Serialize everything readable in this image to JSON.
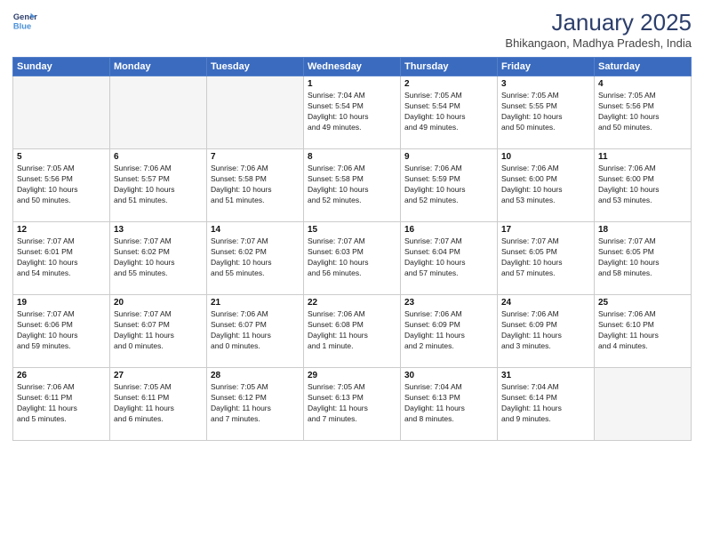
{
  "header": {
    "logo_line1": "General",
    "logo_line2": "Blue",
    "month": "January 2025",
    "location": "Bhikangaon, Madhya Pradesh, India"
  },
  "weekdays": [
    "Sunday",
    "Monday",
    "Tuesday",
    "Wednesday",
    "Thursday",
    "Friday",
    "Saturday"
  ],
  "weeks": [
    [
      {
        "day": "",
        "text": "",
        "shaded": false
      },
      {
        "day": "",
        "text": "",
        "shaded": false
      },
      {
        "day": "",
        "text": "",
        "shaded": false
      },
      {
        "day": "1",
        "text": "Sunrise: 7:04 AM\nSunset: 5:54 PM\nDaylight: 10 hours\nand 49 minutes.",
        "shaded": false
      },
      {
        "day": "2",
        "text": "Sunrise: 7:05 AM\nSunset: 5:54 PM\nDaylight: 10 hours\nand 49 minutes.",
        "shaded": false
      },
      {
        "day": "3",
        "text": "Sunrise: 7:05 AM\nSunset: 5:55 PM\nDaylight: 10 hours\nand 50 minutes.",
        "shaded": false
      },
      {
        "day": "4",
        "text": "Sunrise: 7:05 AM\nSunset: 5:56 PM\nDaylight: 10 hours\nand 50 minutes.",
        "shaded": false
      }
    ],
    [
      {
        "day": "5",
        "text": "Sunrise: 7:05 AM\nSunset: 5:56 PM\nDaylight: 10 hours\nand 50 minutes.",
        "shaded": true
      },
      {
        "day": "6",
        "text": "Sunrise: 7:06 AM\nSunset: 5:57 PM\nDaylight: 10 hours\nand 51 minutes.",
        "shaded": false
      },
      {
        "day": "7",
        "text": "Sunrise: 7:06 AM\nSunset: 5:58 PM\nDaylight: 10 hours\nand 51 minutes.",
        "shaded": false
      },
      {
        "day": "8",
        "text": "Sunrise: 7:06 AM\nSunset: 5:58 PM\nDaylight: 10 hours\nand 52 minutes.",
        "shaded": false
      },
      {
        "day": "9",
        "text": "Sunrise: 7:06 AM\nSunset: 5:59 PM\nDaylight: 10 hours\nand 52 minutes.",
        "shaded": false
      },
      {
        "day": "10",
        "text": "Sunrise: 7:06 AM\nSunset: 6:00 PM\nDaylight: 10 hours\nand 53 minutes.",
        "shaded": false
      },
      {
        "day": "11",
        "text": "Sunrise: 7:06 AM\nSunset: 6:00 PM\nDaylight: 10 hours\nand 53 minutes.",
        "shaded": false
      }
    ],
    [
      {
        "day": "12",
        "text": "Sunrise: 7:07 AM\nSunset: 6:01 PM\nDaylight: 10 hours\nand 54 minutes.",
        "shaded": true
      },
      {
        "day": "13",
        "text": "Sunrise: 7:07 AM\nSunset: 6:02 PM\nDaylight: 10 hours\nand 55 minutes.",
        "shaded": false
      },
      {
        "day": "14",
        "text": "Sunrise: 7:07 AM\nSunset: 6:02 PM\nDaylight: 10 hours\nand 55 minutes.",
        "shaded": false
      },
      {
        "day": "15",
        "text": "Sunrise: 7:07 AM\nSunset: 6:03 PM\nDaylight: 10 hours\nand 56 minutes.",
        "shaded": false
      },
      {
        "day": "16",
        "text": "Sunrise: 7:07 AM\nSunset: 6:04 PM\nDaylight: 10 hours\nand 57 minutes.",
        "shaded": false
      },
      {
        "day": "17",
        "text": "Sunrise: 7:07 AM\nSunset: 6:05 PM\nDaylight: 10 hours\nand 57 minutes.",
        "shaded": false
      },
      {
        "day": "18",
        "text": "Sunrise: 7:07 AM\nSunset: 6:05 PM\nDaylight: 10 hours\nand 58 minutes.",
        "shaded": false
      }
    ],
    [
      {
        "day": "19",
        "text": "Sunrise: 7:07 AM\nSunset: 6:06 PM\nDaylight: 10 hours\nand 59 minutes.",
        "shaded": true
      },
      {
        "day": "20",
        "text": "Sunrise: 7:07 AM\nSunset: 6:07 PM\nDaylight: 11 hours\nand 0 minutes.",
        "shaded": false
      },
      {
        "day": "21",
        "text": "Sunrise: 7:06 AM\nSunset: 6:07 PM\nDaylight: 11 hours\nand 0 minutes.",
        "shaded": false
      },
      {
        "day": "22",
        "text": "Sunrise: 7:06 AM\nSunset: 6:08 PM\nDaylight: 11 hours\nand 1 minute.",
        "shaded": false
      },
      {
        "day": "23",
        "text": "Sunrise: 7:06 AM\nSunset: 6:09 PM\nDaylight: 11 hours\nand 2 minutes.",
        "shaded": false
      },
      {
        "day": "24",
        "text": "Sunrise: 7:06 AM\nSunset: 6:09 PM\nDaylight: 11 hours\nand 3 minutes.",
        "shaded": false
      },
      {
        "day": "25",
        "text": "Sunrise: 7:06 AM\nSunset: 6:10 PM\nDaylight: 11 hours\nand 4 minutes.",
        "shaded": false
      }
    ],
    [
      {
        "day": "26",
        "text": "Sunrise: 7:06 AM\nSunset: 6:11 PM\nDaylight: 11 hours\nand 5 minutes.",
        "shaded": true
      },
      {
        "day": "27",
        "text": "Sunrise: 7:05 AM\nSunset: 6:11 PM\nDaylight: 11 hours\nand 6 minutes.",
        "shaded": false
      },
      {
        "day": "28",
        "text": "Sunrise: 7:05 AM\nSunset: 6:12 PM\nDaylight: 11 hours\nand 7 minutes.",
        "shaded": false
      },
      {
        "day": "29",
        "text": "Sunrise: 7:05 AM\nSunset: 6:13 PM\nDaylight: 11 hours\nand 7 minutes.",
        "shaded": false
      },
      {
        "day": "30",
        "text": "Sunrise: 7:04 AM\nSunset: 6:13 PM\nDaylight: 11 hours\nand 8 minutes.",
        "shaded": false
      },
      {
        "day": "31",
        "text": "Sunrise: 7:04 AM\nSunset: 6:14 PM\nDaylight: 11 hours\nand 9 minutes.",
        "shaded": false
      },
      {
        "day": "",
        "text": "",
        "shaded": false
      }
    ]
  ]
}
